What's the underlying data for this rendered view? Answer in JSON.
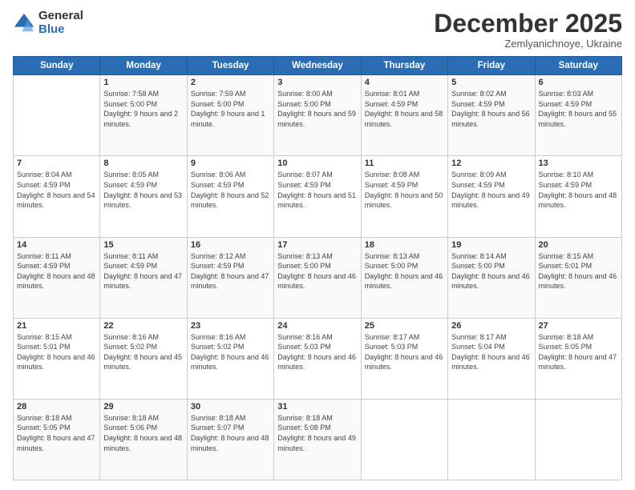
{
  "logo": {
    "general": "General",
    "blue": "Blue"
  },
  "header": {
    "month": "December 2025",
    "location": "Zemlyanichnoye, Ukraine"
  },
  "days_of_week": [
    "Sunday",
    "Monday",
    "Tuesday",
    "Wednesday",
    "Thursday",
    "Friday",
    "Saturday"
  ],
  "weeks": [
    [
      {
        "day": "",
        "sunrise": "",
        "sunset": "",
        "daylight": ""
      },
      {
        "day": "1",
        "sunrise": "Sunrise: 7:58 AM",
        "sunset": "Sunset: 5:00 PM",
        "daylight": "Daylight: 9 hours and 2 minutes."
      },
      {
        "day": "2",
        "sunrise": "Sunrise: 7:59 AM",
        "sunset": "Sunset: 5:00 PM",
        "daylight": "Daylight: 9 hours and 1 minute."
      },
      {
        "day": "3",
        "sunrise": "Sunrise: 8:00 AM",
        "sunset": "Sunset: 5:00 PM",
        "daylight": "Daylight: 8 hours and 59 minutes."
      },
      {
        "day": "4",
        "sunrise": "Sunrise: 8:01 AM",
        "sunset": "Sunset: 4:59 PM",
        "daylight": "Daylight: 8 hours and 58 minutes."
      },
      {
        "day": "5",
        "sunrise": "Sunrise: 8:02 AM",
        "sunset": "Sunset: 4:59 PM",
        "daylight": "Daylight: 8 hours and 56 minutes."
      },
      {
        "day": "6",
        "sunrise": "Sunrise: 8:03 AM",
        "sunset": "Sunset: 4:59 PM",
        "daylight": "Daylight: 8 hours and 55 minutes."
      }
    ],
    [
      {
        "day": "7",
        "sunrise": "Sunrise: 8:04 AM",
        "sunset": "Sunset: 4:59 PM",
        "daylight": "Daylight: 8 hours and 54 minutes."
      },
      {
        "day": "8",
        "sunrise": "Sunrise: 8:05 AM",
        "sunset": "Sunset: 4:59 PM",
        "daylight": "Daylight: 8 hours and 53 minutes."
      },
      {
        "day": "9",
        "sunrise": "Sunrise: 8:06 AM",
        "sunset": "Sunset: 4:59 PM",
        "daylight": "Daylight: 8 hours and 52 minutes."
      },
      {
        "day": "10",
        "sunrise": "Sunrise: 8:07 AM",
        "sunset": "Sunset: 4:59 PM",
        "daylight": "Daylight: 8 hours and 51 minutes."
      },
      {
        "day": "11",
        "sunrise": "Sunrise: 8:08 AM",
        "sunset": "Sunset: 4:59 PM",
        "daylight": "Daylight: 8 hours and 50 minutes."
      },
      {
        "day": "12",
        "sunrise": "Sunrise: 8:09 AM",
        "sunset": "Sunset: 4:59 PM",
        "daylight": "Daylight: 8 hours and 49 minutes."
      },
      {
        "day": "13",
        "sunrise": "Sunrise: 8:10 AM",
        "sunset": "Sunset: 4:59 PM",
        "daylight": "Daylight: 8 hours and 48 minutes."
      }
    ],
    [
      {
        "day": "14",
        "sunrise": "Sunrise: 8:11 AM",
        "sunset": "Sunset: 4:59 PM",
        "daylight": "Daylight: 8 hours and 48 minutes."
      },
      {
        "day": "15",
        "sunrise": "Sunrise: 8:11 AM",
        "sunset": "Sunset: 4:59 PM",
        "daylight": "Daylight: 8 hours and 47 minutes."
      },
      {
        "day": "16",
        "sunrise": "Sunrise: 8:12 AM",
        "sunset": "Sunset: 4:59 PM",
        "daylight": "Daylight: 8 hours and 47 minutes."
      },
      {
        "day": "17",
        "sunrise": "Sunrise: 8:13 AM",
        "sunset": "Sunset: 5:00 PM",
        "daylight": "Daylight: 8 hours and 46 minutes."
      },
      {
        "day": "18",
        "sunrise": "Sunrise: 8:13 AM",
        "sunset": "Sunset: 5:00 PM",
        "daylight": "Daylight: 8 hours and 46 minutes."
      },
      {
        "day": "19",
        "sunrise": "Sunrise: 8:14 AM",
        "sunset": "Sunset: 5:00 PM",
        "daylight": "Daylight: 8 hours and 46 minutes."
      },
      {
        "day": "20",
        "sunrise": "Sunrise: 8:15 AM",
        "sunset": "Sunset: 5:01 PM",
        "daylight": "Daylight: 8 hours and 46 minutes."
      }
    ],
    [
      {
        "day": "21",
        "sunrise": "Sunrise: 8:15 AM",
        "sunset": "Sunset: 5:01 PM",
        "daylight": "Daylight: 8 hours and 46 minutes."
      },
      {
        "day": "22",
        "sunrise": "Sunrise: 8:16 AM",
        "sunset": "Sunset: 5:02 PM",
        "daylight": "Daylight: 8 hours and 45 minutes."
      },
      {
        "day": "23",
        "sunrise": "Sunrise: 8:16 AM",
        "sunset": "Sunset: 5:02 PM",
        "daylight": "Daylight: 8 hours and 46 minutes."
      },
      {
        "day": "24",
        "sunrise": "Sunrise: 8:16 AM",
        "sunset": "Sunset: 5:03 PM",
        "daylight": "Daylight: 8 hours and 46 minutes."
      },
      {
        "day": "25",
        "sunrise": "Sunrise: 8:17 AM",
        "sunset": "Sunset: 5:03 PM",
        "daylight": "Daylight: 8 hours and 46 minutes."
      },
      {
        "day": "26",
        "sunrise": "Sunrise: 8:17 AM",
        "sunset": "Sunset: 5:04 PM",
        "daylight": "Daylight: 8 hours and 46 minutes."
      },
      {
        "day": "27",
        "sunrise": "Sunrise: 8:18 AM",
        "sunset": "Sunset: 5:05 PM",
        "daylight": "Daylight: 8 hours and 47 minutes."
      }
    ],
    [
      {
        "day": "28",
        "sunrise": "Sunrise: 8:18 AM",
        "sunset": "Sunset: 5:05 PM",
        "daylight": "Daylight: 8 hours and 47 minutes."
      },
      {
        "day": "29",
        "sunrise": "Sunrise: 8:18 AM",
        "sunset": "Sunset: 5:06 PM",
        "daylight": "Daylight: 8 hours and 48 minutes."
      },
      {
        "day": "30",
        "sunrise": "Sunrise: 8:18 AM",
        "sunset": "Sunset: 5:07 PM",
        "daylight": "Daylight: 8 hours and 48 minutes."
      },
      {
        "day": "31",
        "sunrise": "Sunrise: 8:18 AM",
        "sunset": "Sunset: 5:08 PM",
        "daylight": "Daylight: 8 hours and 49 minutes."
      },
      {
        "day": "",
        "sunrise": "",
        "sunset": "",
        "daylight": ""
      },
      {
        "day": "",
        "sunrise": "",
        "sunset": "",
        "daylight": ""
      },
      {
        "day": "",
        "sunrise": "",
        "sunset": "",
        "daylight": ""
      }
    ]
  ]
}
